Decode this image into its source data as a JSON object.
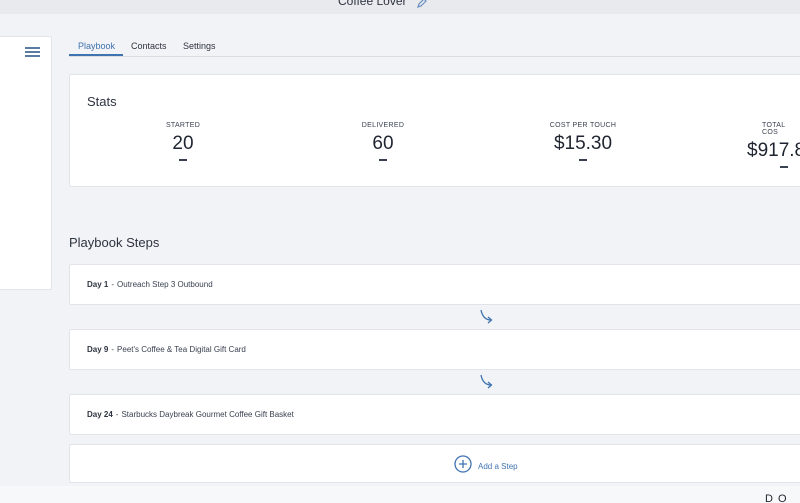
{
  "header": {
    "title": "Coffee Lover",
    "edit_icon": "pencil-icon"
  },
  "sidebar": {
    "menu_icon": "hamburger-menu-icon"
  },
  "tabs": [
    {
      "label": "Playbook",
      "active": true
    },
    {
      "label": "Contacts",
      "active": false
    },
    {
      "label": "Settings",
      "active": false
    }
  ],
  "stats": {
    "title": "Stats",
    "items": [
      {
        "label": "STARTED",
        "value": "20"
      },
      {
        "label": "DELIVERED",
        "value": "60"
      },
      {
        "label": "COST PER TOUCH",
        "value": "$15.30"
      },
      {
        "label": "TOTAL COS",
        "value": "$917.8"
      }
    ]
  },
  "steps": {
    "heading": "Playbook Steps",
    "separator": "-",
    "items": [
      {
        "day": "Day 1",
        "name": "Outreach Step 3 Outbound"
      },
      {
        "day": "Day 9",
        "name": "Peet's Coffee & Tea Digital Gift Card"
      },
      {
        "day": "Day 24",
        "name": "Starbucks Daybreak Gourmet Coffee Gift Basket"
      }
    ],
    "connector_icon": "curved-arrow-down-icon",
    "add_step_label": "Add a Step",
    "add_icon": "plus-circle-icon"
  },
  "footer": {
    "corner_text": "D O C"
  },
  "colors": {
    "accent": "#3f73b0",
    "background": "#f2f3f6",
    "card": "#ffffff"
  }
}
